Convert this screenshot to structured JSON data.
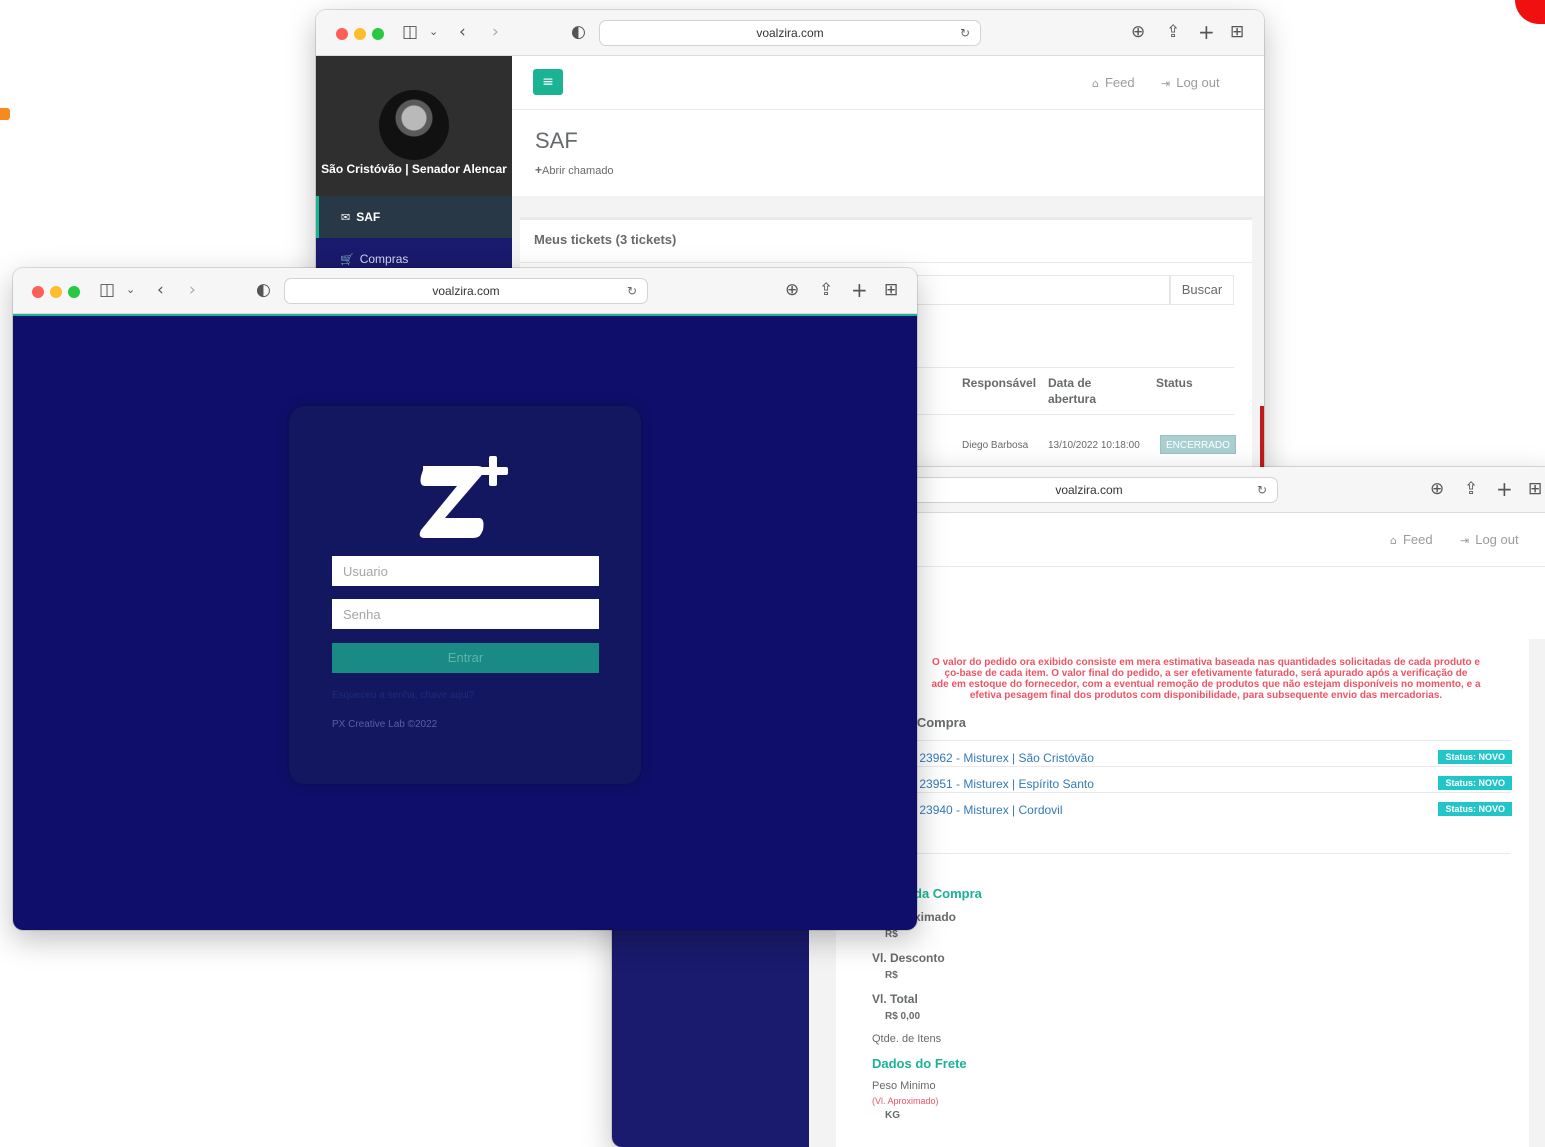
{
  "colors": {
    "accent": "#1ab394",
    "sidebar": "#1a1a6e",
    "login_bg": "#0f0f6b",
    "danger": "#ed5565",
    "info": "#23c6c8",
    "link": "#337ab7"
  },
  "saf_window": {
    "url": "voalzira.com",
    "profile_name": "São Cristóvão | Senador Alencar",
    "nav": {
      "saf": "SAF",
      "compras": "Compras"
    },
    "topnav": {
      "feed": "Feed",
      "logout": "Log out"
    },
    "title": "SAF",
    "abrir_chamado": "Abrir chamado",
    "tickets_title": "Meus tickets (3 tickets)",
    "search_button": "Buscar",
    "columns": {
      "responsavel": "Responsável",
      "data": "Data de abertura",
      "status": "Status"
    },
    "row": {
      "responsavel": "Diego Barbosa",
      "data": "13/10/2022 10:18:00",
      "status": "ENCERRADO"
    }
  },
  "login_window": {
    "url": "voalzira.com",
    "user_placeholder": "Usuario",
    "pass_placeholder": "Senha",
    "submit": "Entrar",
    "forgot": "Esqueceu a senha, chave aqui?",
    "copyright": "PX Creative Lab ©2022"
  },
  "compras_window": {
    "url": "voalzira.com",
    "topnav": {
      "feed": "Feed",
      "logout": "Log out"
    },
    "warning_lines": [
      "O valor do pedido ora exibido consiste em mera estimativa baseada nas quantidades solicitadas de cada produto e",
      "ço-base de cada item. O valor final do pedido, a ser efetivamente faturado, será apurado após a verificação de",
      "ade em estoque do fornecedor, com a eventual remoção de produtos que não estejam disponíveis no momento, e a",
      "efetiva pesagem final dos produtos com disponibilidade, para subsequente envio das mercadorias."
    ],
    "section_title": "e Compra",
    "orders": [
      {
        "label": "o:  23962 - Misturex | São Cristóvão",
        "status": "Status: NOVO"
      },
      {
        "label": "o:  23951 - Misturex | Espírito Santo",
        "status": "Status: NOVO"
      },
      {
        "label": "o:  23940 - Misturex | Cordovil",
        "status": "Status: NOVO"
      }
    ],
    "resumo_title": "da Compra",
    "aprox_label": "ximado",
    "aprox_value": "R$",
    "desconto_label": "Vl. Desconto",
    "desconto_value": "R$",
    "total_label": "Vl. Total",
    "total_value": "R$ 0,00",
    "qtde_label": "Qtde. de Itens",
    "frete_title": "Dados do Frete",
    "peso_label": "Peso Minimo",
    "peso_note": "(Vl. Aproximado)",
    "peso_value": "KG"
  }
}
